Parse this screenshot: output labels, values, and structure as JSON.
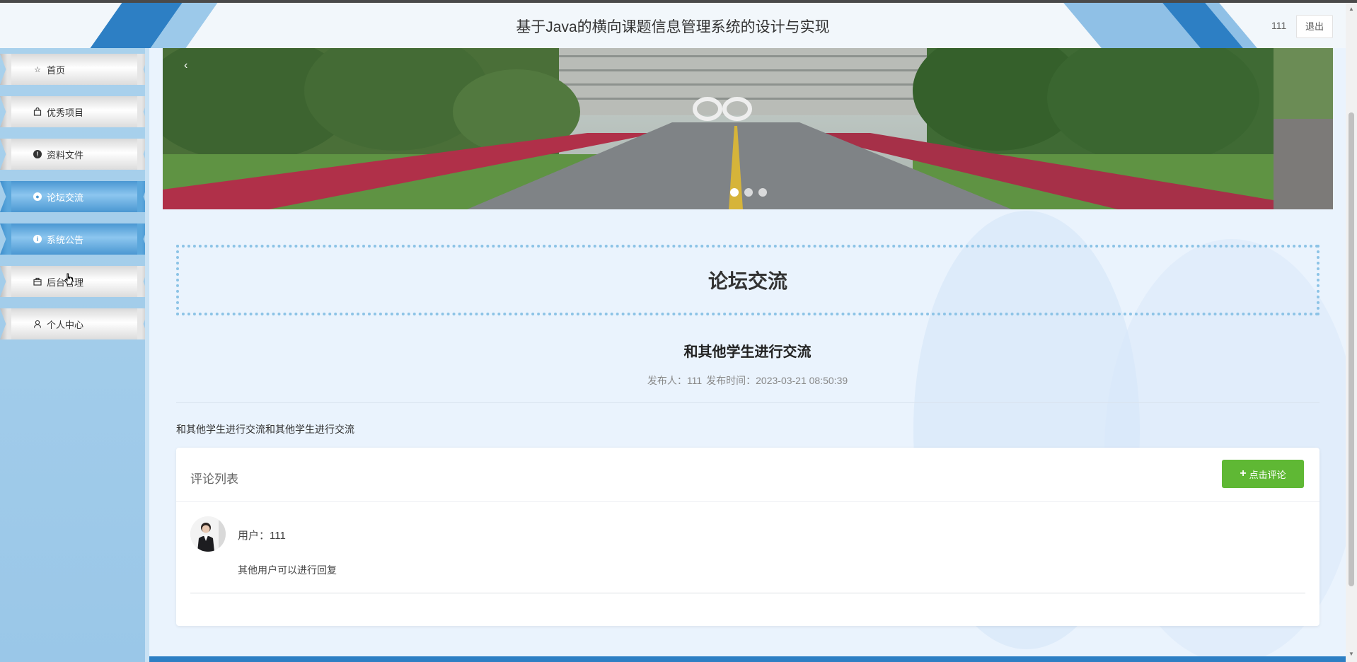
{
  "header": {
    "title": "基于Java的横向课题信息管理系统的设计与实现",
    "username": "111",
    "logout_label": "退出"
  },
  "sidebar": {
    "items": [
      {
        "label": "首页",
        "icon": "home-icon"
      },
      {
        "label": "优秀项目",
        "icon": "bag-icon"
      },
      {
        "label": "资料文件",
        "icon": "info-circle-icon"
      },
      {
        "label": "论坛交流",
        "icon": "forum-icon",
        "active": true
      },
      {
        "label": "系统公告",
        "icon": "notice-icon"
      },
      {
        "label": "后台管理",
        "icon": "briefcase-icon"
      },
      {
        "label": "个人中心",
        "icon": "user-icon"
      }
    ]
  },
  "banner": {
    "dots": 3,
    "active_dot": 1
  },
  "section": {
    "title": "论坛交流"
  },
  "post": {
    "title": "和其他学生进行交流",
    "author_label": "发布人：111",
    "time_label": "发布时间：2023-03-21 08:50:39",
    "body": "和其他学生进行交流和其他学生进行交流"
  },
  "comments": {
    "header": "评论列表",
    "add_button": "点击评论",
    "items": [
      {
        "user": "用户：111",
        "text": "其他用户可以进行回复"
      }
    ]
  },
  "colors": {
    "accent": "#2d7fc4",
    "sidebar_active": "#5ba7dc",
    "add_button": "#5fb834"
  }
}
